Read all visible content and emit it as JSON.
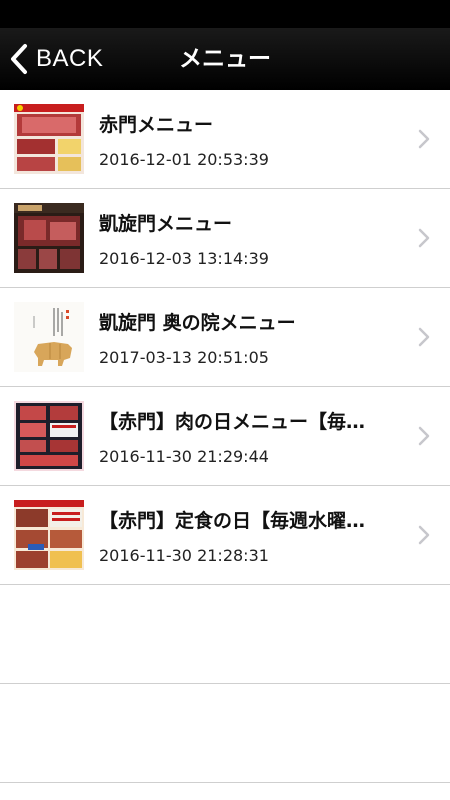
{
  "nav": {
    "back_label": "BACK",
    "title": "メニュー"
  },
  "items": [
    {
      "title": "赤門メニュー",
      "date": "2016-12-01 20:53:39",
      "thumb": "menu-photo-red-beef"
    },
    {
      "title": "凱旋門メニュー",
      "date": "2016-12-03 13:14:39",
      "thumb": "menu-photo-dark-beef"
    },
    {
      "title": "凱旋門 奥の院メニュー",
      "date": "2017-03-13 20:51:05",
      "thumb": "menu-cover-beef-illustration"
    },
    {
      "title": "【赤門】肉の日メニュー【毎…",
      "date": "2016-11-30 21:29:44",
      "thumb": "menu-flyer-meat-day"
    },
    {
      "title": "【赤門】定食の日【毎週水曜…",
      "date": "2016-11-30 21:28:31",
      "thumb": "menu-flyer-set-meal-day"
    }
  ],
  "colors": {
    "nav_background": "#000000",
    "nav_text": "#ffffff",
    "separator": "#cfcfcf",
    "chevron": "#c7c7cc"
  }
}
